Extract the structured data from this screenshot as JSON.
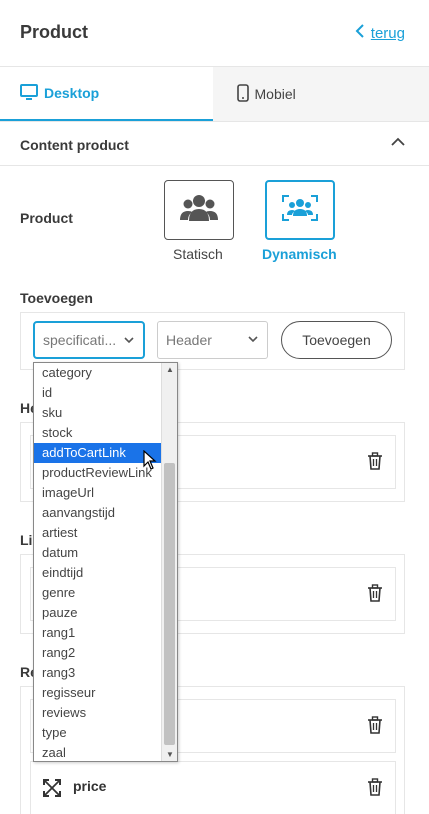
{
  "header": {
    "title": "Product",
    "back_label": "terug"
  },
  "tabs": [
    {
      "label": "Desktop",
      "icon": "desktop-icon",
      "active": true
    },
    {
      "label": "Mobiel",
      "icon": "mobile-icon",
      "active": false
    }
  ],
  "section": {
    "title": "Content product"
  },
  "product": {
    "label": "Product",
    "modes": [
      {
        "label": "Statisch",
        "icon": "users-icon"
      },
      {
        "label": "Dynamisch",
        "icon": "users-focus-icon",
        "selected": true
      }
    ]
  },
  "add": {
    "label": "Toevoegen",
    "field_select_value": "specificati...",
    "type_select_value": "Header",
    "button_label": "Toevoegen"
  },
  "groups": [
    {
      "label": "He"
    },
    {
      "label": "Li"
    },
    {
      "label": "Re",
      "items": [
        {
          "label": "price",
          "icon": "move-icon"
        }
      ]
    }
  ],
  "dropdown": {
    "options": [
      "category",
      "id",
      "sku",
      "stock",
      "addToCartLink",
      "productReviewLink",
      "imageUrl",
      "aanvangstijd",
      "artiest",
      "datum",
      "eindtijd",
      "genre",
      "pauze",
      "rang1",
      "rang2",
      "rang3",
      "regisseur",
      "reviews",
      "type",
      "zaal"
    ],
    "highlighted": "addToCartLink"
  },
  "colors": {
    "accent": "#1aa0d8",
    "highlight": "#1a73e8"
  }
}
